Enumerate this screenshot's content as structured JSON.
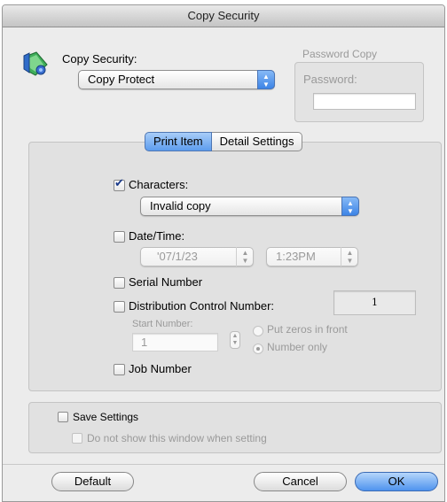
{
  "window": {
    "title": "Copy Security"
  },
  "copy_security": {
    "label": "Copy Security:",
    "selected": "Copy Protect",
    "icon": "copy-security-shield-icon"
  },
  "password_copy": {
    "group_label": "Password Copy",
    "password_label": "Password:",
    "password_value": ""
  },
  "tabs": [
    {
      "label": "Print Item",
      "active": true
    },
    {
      "label": "Detail Settings",
      "active": false
    }
  ],
  "print_items": {
    "characters": {
      "label": "Characters:",
      "checked": true,
      "selected": "Invalid copy"
    },
    "date_time": {
      "label": "Date/Time:",
      "checked": false,
      "date_value": "'07/1/23",
      "time_value": "1:23PM"
    },
    "serial_number": {
      "label": "Serial Number",
      "checked": false
    },
    "distribution_control": {
      "label": "Distribution Control Number:",
      "checked": false,
      "value": "1",
      "start_number_label": "Start Number:",
      "start_number_value": "1",
      "radio_zeros": "Put zeros in front",
      "radio_number_only": "Number only",
      "selected_radio": "Number only"
    },
    "job_number": {
      "label": "Job Number",
      "checked": false
    }
  },
  "save_settings": {
    "label": "Save Settings",
    "checked": false,
    "sub_label": "Do not show this window when setting"
  },
  "buttons": {
    "default": "Default",
    "cancel": "Cancel",
    "ok": "OK"
  },
  "colors": {
    "accent": "#5d9cee"
  }
}
